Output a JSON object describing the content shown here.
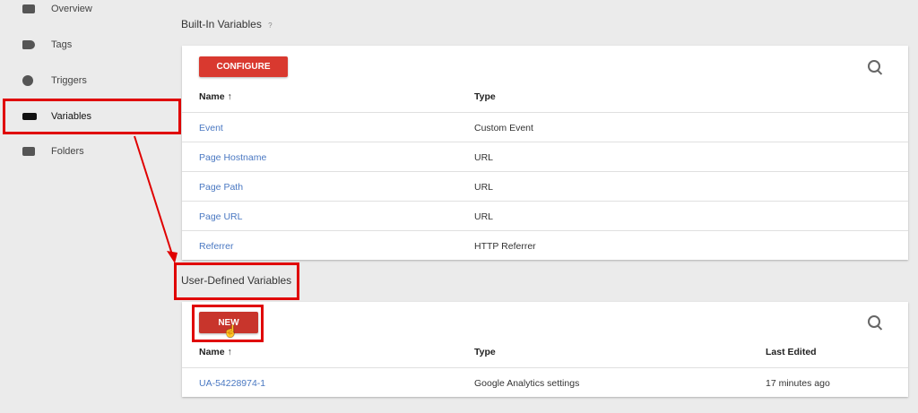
{
  "sidebar": {
    "items": [
      {
        "label": "Overview",
        "icon": "briefcase-icon"
      },
      {
        "label": "Tags",
        "icon": "tag-icon"
      },
      {
        "label": "Triggers",
        "icon": "trigger-icon"
      },
      {
        "label": "Variables",
        "icon": "blocks-icon",
        "active": true
      },
      {
        "label": "Folders",
        "icon": "folder-icon"
      }
    ]
  },
  "builtin": {
    "title": "Built-In Variables",
    "help": "?",
    "configure_label": "CONFIGURE",
    "col_name": "Name ↑",
    "col_type": "Type",
    "rows": [
      {
        "name": "Event",
        "type": "Custom Event"
      },
      {
        "name": "Page Hostname",
        "type": "URL"
      },
      {
        "name": "Page Path",
        "type": "URL"
      },
      {
        "name": "Page URL",
        "type": "URL"
      },
      {
        "name": "Referrer",
        "type": "HTTP Referrer"
      }
    ]
  },
  "userdefined": {
    "title": "User-Defined Variables",
    "new_label": "NEW",
    "col_name": "Name ↑",
    "col_type": "Type",
    "col_edited": "Last Edited",
    "rows": [
      {
        "name": "UA-54228974-1",
        "type": "Google Analytics settings",
        "edited": "17 minutes ago"
      }
    ]
  },
  "colors": {
    "accent": "#d9392f",
    "link": "#4a78c2",
    "highlight": "#e00000"
  }
}
